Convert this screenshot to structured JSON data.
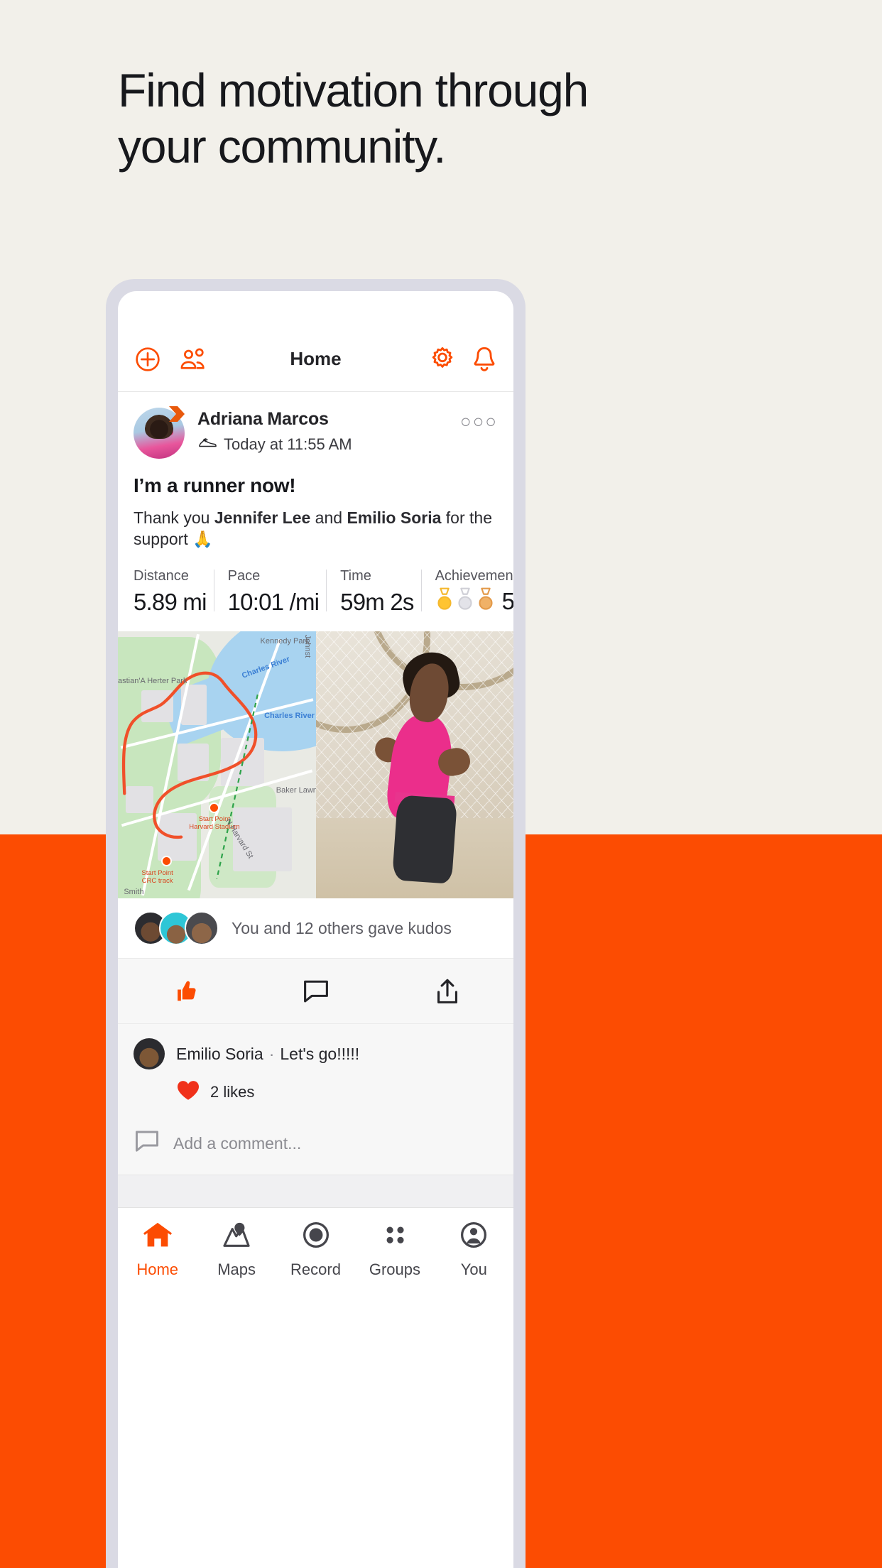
{
  "hero": {
    "headline": "Find motivation through your community."
  },
  "colors": {
    "background": "#f2f0ea",
    "brand_orange": "#fc4c02",
    "text_dark": "#17181c",
    "phone_bezel": "#dadae4"
  },
  "app": {
    "header": {
      "title": "Home",
      "icons": {
        "add": "plus-circle-icon",
        "groups": "people-icon",
        "settings": "gear-icon",
        "notifications": "bell-icon"
      }
    },
    "post": {
      "author": "Adriana Marcos",
      "activity_icon": "running-shoe-icon",
      "timestamp": "Today at 11:55 AM",
      "more_label": "○○○",
      "title": "I’m a runner now!",
      "description_prefix": "Thank you ",
      "mention_one": "Jennifer Lee",
      "description_middle": " and ",
      "mention_two": "Emilio Soria",
      "description_suffix": " for the support ",
      "description_emoji": "🙏",
      "stats": [
        {
          "label": "Distance",
          "value": "5.89 mi"
        },
        {
          "label": "Pace",
          "value": "10:01 /mi"
        },
        {
          "label": "Time",
          "value": "59m 2s"
        }
      ],
      "achievements": {
        "label": "Achievements",
        "count": "5",
        "medals": [
          "gold",
          "silver",
          "bronze"
        ]
      },
      "map": {
        "river_label": "Charles River",
        "river_label_2": "Charles River",
        "park_label": "Kennedy Park",
        "park_label_2": "astian'A Herter Park",
        "lawn_label": "Baker Lawn",
        "street_label": "N Harvard St",
        "start_point_1_title": "Start Point",
        "start_point_1_name": "Harvard Stadium",
        "start_point_2_title": "Start Point",
        "start_point_2_name": "CRC track",
        "smith_label": "Smith",
        "johnst_label": "Johnst"
      }
    },
    "kudos": {
      "text": "You and 12 others gave kudos",
      "avatar_count": 3
    },
    "actions": {
      "kudos_icon": "thumbs-up-icon",
      "comment_icon": "comment-icon",
      "share_icon": "share-icon"
    },
    "comments": {
      "author": "Emilio Soria",
      "separator": "·",
      "text": "Let's go!!!!!",
      "likes": "2 likes",
      "heart_icon": "heart-icon",
      "add_placeholder": "Add a comment...",
      "add_icon": "comment-outline-icon"
    },
    "tabbar": [
      {
        "label": "Home",
        "icon": "home-icon",
        "active": true
      },
      {
        "label": "Maps",
        "icon": "map-icon",
        "active": false
      },
      {
        "label": "Record",
        "icon": "record-icon",
        "active": false
      },
      {
        "label": "Groups",
        "icon": "groups-icon",
        "active": false
      },
      {
        "label": "You",
        "icon": "person-icon",
        "active": false
      }
    ]
  }
}
